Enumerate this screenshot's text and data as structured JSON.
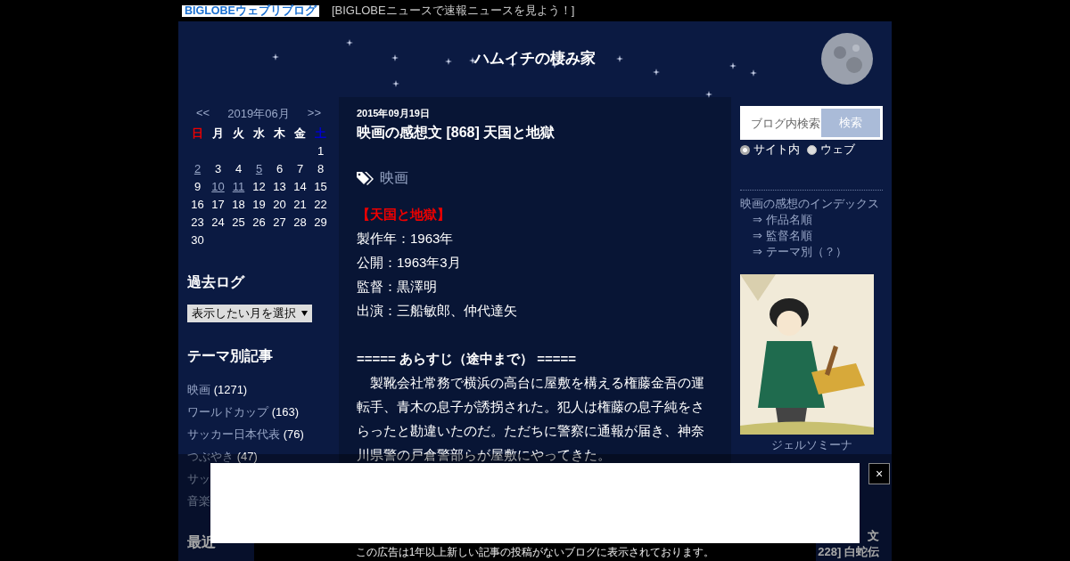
{
  "topbar": {
    "logo": "BIGLOBEウェブリブログ",
    "link": "[BIGLOBEニュースで速報ニュースを見よう！]"
  },
  "header": {
    "title": "ハムイチの棲み家"
  },
  "calendar": {
    "prev": "<<",
    "month": "2019年06月",
    "next": ">>",
    "weekdays": [
      {
        "label": "日",
        "kind": "sunday"
      },
      {
        "label": "月",
        "kind": "weekday"
      },
      {
        "label": "火",
        "kind": "weekday"
      },
      {
        "label": "水",
        "kind": "weekday"
      },
      {
        "label": "木",
        "kind": "weekday"
      },
      {
        "label": "金",
        "kind": "weekday"
      },
      {
        "label": "土",
        "kind": "saturday"
      }
    ],
    "weeks": [
      {
        "days": [
          {
            "day": "1",
            "linked": false
          }
        ]
      },
      {
        "days": [
          {
            "day": "2",
            "linked": true
          },
          {
            "day": "3",
            "linked": false
          },
          {
            "day": "4",
            "linked": false
          },
          {
            "day": "5",
            "linked": true
          },
          {
            "day": "6",
            "linked": false
          },
          {
            "day": "7",
            "linked": false
          },
          {
            "day": "8",
            "linked": false
          }
        ]
      },
      {
        "days": [
          {
            "day": "9",
            "linked": false
          },
          {
            "day": "10",
            "linked": true
          },
          {
            "day": "11",
            "linked": true
          },
          {
            "day": "12",
            "linked": false
          },
          {
            "day": "13",
            "linked": false
          },
          {
            "day": "14",
            "linked": false
          },
          {
            "day": "15",
            "linked": false
          }
        ]
      },
      {
        "days": [
          {
            "day": "16",
            "linked": false
          },
          {
            "day": "17",
            "linked": false
          },
          {
            "day": "18",
            "linked": false
          },
          {
            "day": "19",
            "linked": false
          },
          {
            "day": "20",
            "linked": false
          },
          {
            "day": "21",
            "linked": false
          },
          {
            "day": "22",
            "linked": false
          }
        ]
      },
      {
        "days": [
          {
            "day": "23",
            "linked": false
          },
          {
            "day": "24",
            "linked": false
          },
          {
            "day": "25",
            "linked": false
          },
          {
            "day": "26",
            "linked": false
          },
          {
            "day": "27",
            "linked": false
          },
          {
            "day": "28",
            "linked": false
          },
          {
            "day": "29",
            "linked": false
          }
        ]
      },
      {
        "days": [
          {
            "day": "30",
            "linked": false
          }
        ]
      }
    ]
  },
  "archive": {
    "heading": "過去ログ",
    "select": "表示したい月を選択"
  },
  "themes": {
    "heading": "テーマ別記事",
    "items": [
      {
        "label": "映画",
        "count": "(1271)"
      },
      {
        "label": "ワールドカップ",
        "count": "(163)"
      },
      {
        "label": "サッカー日本代表",
        "count": "(76)"
      },
      {
        "label": "つぶやき",
        "count": "(47)"
      },
      {
        "label": "サッ"
      },
      {
        "label": "音楽"
      }
    ]
  },
  "recent": {
    "heading": "最近"
  },
  "article": {
    "date": "2015年09月19日",
    "title": "映画の感想文 [868] 天国と地獄",
    "tag": "映画",
    "film_title": "【天国と地獄】",
    "facts": [
      "製作年：1963年",
      "公開：1963年3月",
      "監督：黒澤明",
      "出演：三船敏郎、仲代達矢"
    ],
    "section_heading": "===== あらすじ（途中まで） =====",
    "paragraph": "　製靴会社常務で横浜の高台に屋敷を構える権藤金吾の運転手、青木の息子が誘拐された。犯人は権藤の息子純をさらったと勘違いたのだ。ただちに警察に通報が届き、神奈川県警の戸倉警部らが屋敷にやってきた。"
  },
  "search": {
    "placeholder": "ブログ内検索",
    "button": "検索",
    "options": [
      {
        "label": "サイト内",
        "selected": true
      },
      {
        "label": "ウェブ",
        "selected": false
      }
    ]
  },
  "index": {
    "heading": "映画の感想のインデックス",
    "links": [
      "⇒ 作品名順",
      "⇒ 監督名順",
      "⇒ テーマ別（？）"
    ]
  },
  "profile": {
    "caption": "ジェルソミーナ"
  },
  "recent_right": [
    "文",
    "228] 白蛇伝"
  ],
  "ad": {
    "close": "×",
    "notice": "この広告は1年以上新しい記事の投稿がないブログに表示されております。"
  }
}
